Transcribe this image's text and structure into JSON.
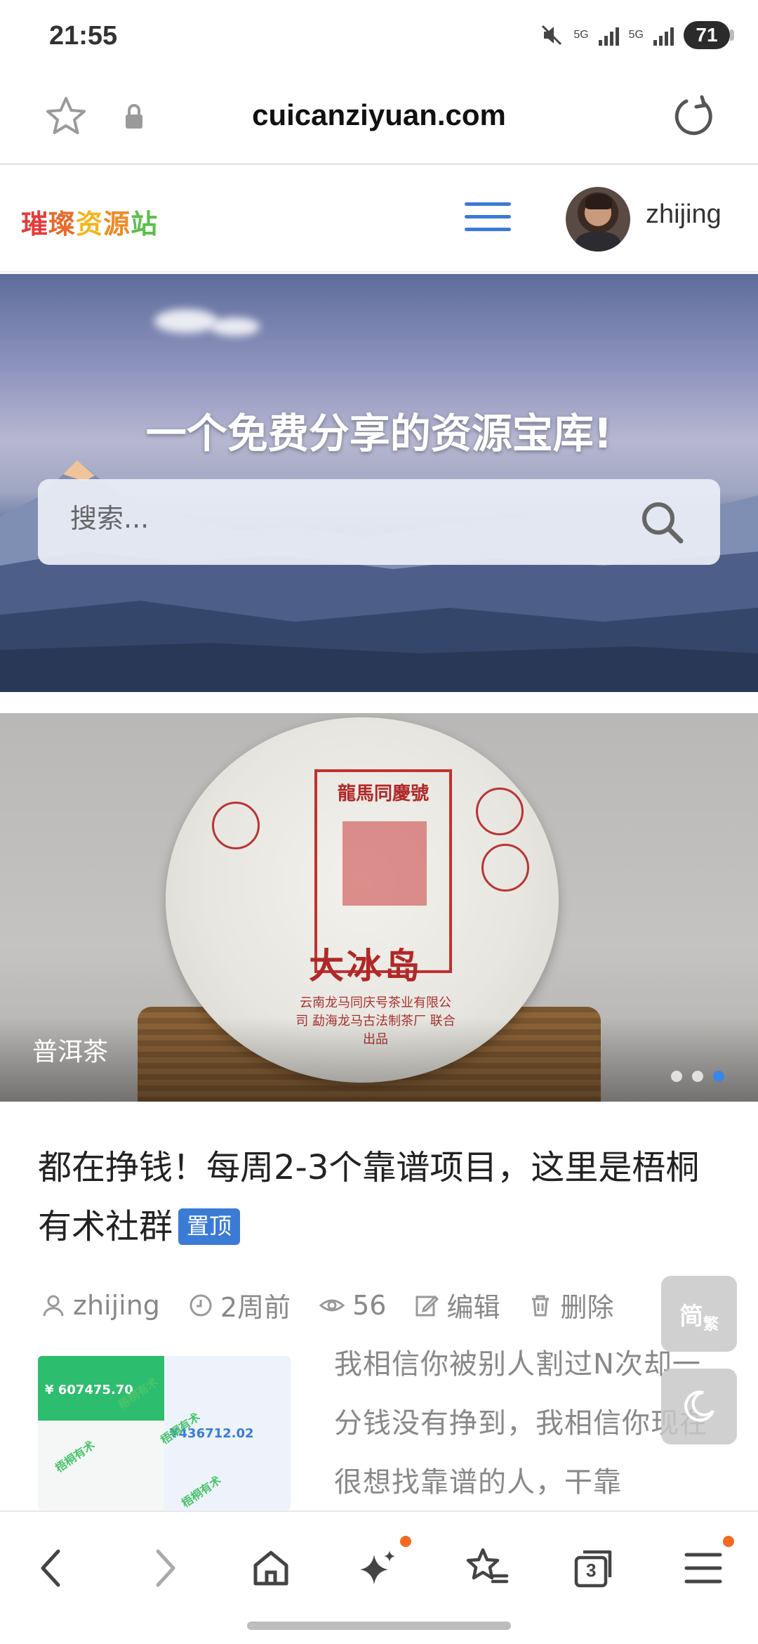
{
  "status_bar": {
    "time": "21:55",
    "network_1": "5G",
    "network_2": "5G",
    "battery": "71"
  },
  "browser": {
    "url": "cuicanziyuan.com",
    "tabs_count": "3"
  },
  "site_header": {
    "logo_chars": [
      "璀",
      "璨",
      "资",
      "源",
      "站"
    ],
    "username": "zhijing"
  },
  "hero": {
    "title": "一个免费分享的资源宝库!",
    "search_placeholder": "搜索..."
  },
  "slider": {
    "caption": "普洱茶",
    "image_text": {
      "brand": "龍馬同慶號",
      "product": "大冰岛",
      "company": "云南龙马同庆号茶业有限公司 勐海龙马古法制茶厂 联合出品"
    },
    "dots": 3,
    "active_dot": 2
  },
  "post": {
    "title": "都在挣钱！每周2-3个靠谱项目，这里是梧桐有术社群",
    "pin_label": "置顶",
    "author": "zhijing",
    "time": "2周前",
    "views": "56",
    "edit_label": "编辑",
    "delete_label": "删除",
    "excerpt": "我相信你被别人割过N次却一分钱没有挣到，我相信你现在很想找靠谱的人，干靠",
    "thumb": {
      "amount_left": "¥ 607475.70",
      "amount_right": "¥436712.02",
      "watermark": "梧桐有术"
    }
  },
  "floating": {
    "simplified_label": "简",
    "traditional_label": "繁"
  }
}
